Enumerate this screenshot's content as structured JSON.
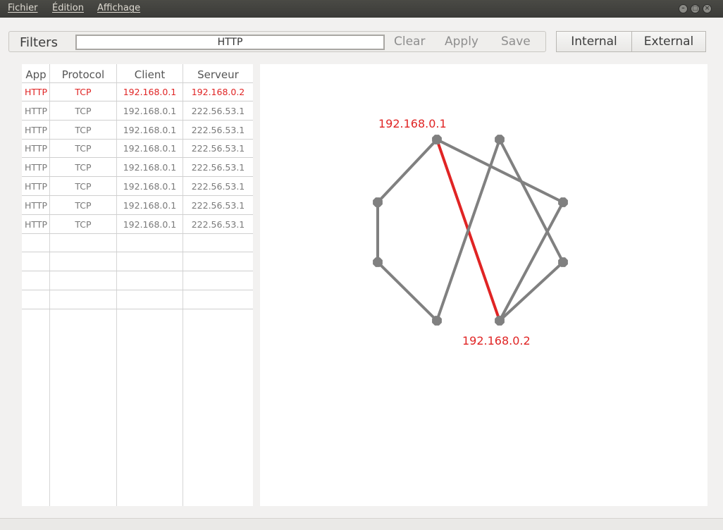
{
  "menu": {
    "items": [
      {
        "label": "Fichier"
      },
      {
        "label": "Édition"
      },
      {
        "label": "Affichage"
      }
    ]
  },
  "toolbar": {
    "filters_label": "Filters",
    "filter_value": "HTTP",
    "clear_label": "Clear",
    "apply_label": "Apply",
    "save_label": "Save",
    "internal_label": "Internal",
    "external_label": "External"
  },
  "table": {
    "columns": [
      "App",
      "Protocol",
      "Client",
      "Serveur"
    ],
    "selected_index": 0,
    "rows": [
      {
        "app": "HTTP",
        "protocol": "TCP",
        "client": "192.168.0.1",
        "server": "192.168.0.2"
      },
      {
        "app": "HTTP",
        "protocol": "TCP",
        "client": "192.168.0.1",
        "server": "222.56.53.1"
      },
      {
        "app": "HTTP",
        "protocol": "TCP",
        "client": "192.168.0.1",
        "server": "222.56.53.1"
      },
      {
        "app": "HTTP",
        "protocol": "TCP",
        "client": "192.168.0.1",
        "server": "222.56.53.1"
      },
      {
        "app": "HTTP",
        "protocol": "TCP",
        "client": "192.168.0.1",
        "server": "222.56.53.1"
      },
      {
        "app": "HTTP",
        "protocol": "TCP",
        "client": "192.168.0.1",
        "server": "222.56.53.1"
      },
      {
        "app": "HTTP",
        "protocol": "TCP",
        "client": "192.168.0.1",
        "server": "222.56.53.1"
      },
      {
        "app": "HTTP",
        "protocol": "TCP",
        "client": "192.168.0.1",
        "server": "222.56.53.1"
      }
    ],
    "empty_rows": 4
  },
  "graph": {
    "highlight_color": "#e02424",
    "edge_color": "#808080",
    "node_color": "#808080",
    "source_label": "192.168.0.1",
    "target_label": "192.168.0.2"
  }
}
